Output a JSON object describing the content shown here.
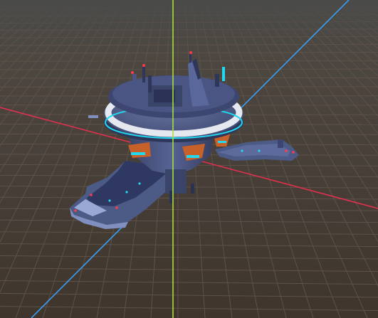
{
  "scene": {
    "background_color": "#3f352c",
    "grid_color": "#5e5249",
    "x_axis_color": "#e0304f",
    "y_axis_color": "#a7e03a",
    "z_axis_color": "#3a9df0",
    "model": {
      "hull_color": "#4c5a86",
      "accent_color": "#22d8ef",
      "stripe_color": "#e6e8f0",
      "orange_accent": "#c8602a"
    }
  }
}
